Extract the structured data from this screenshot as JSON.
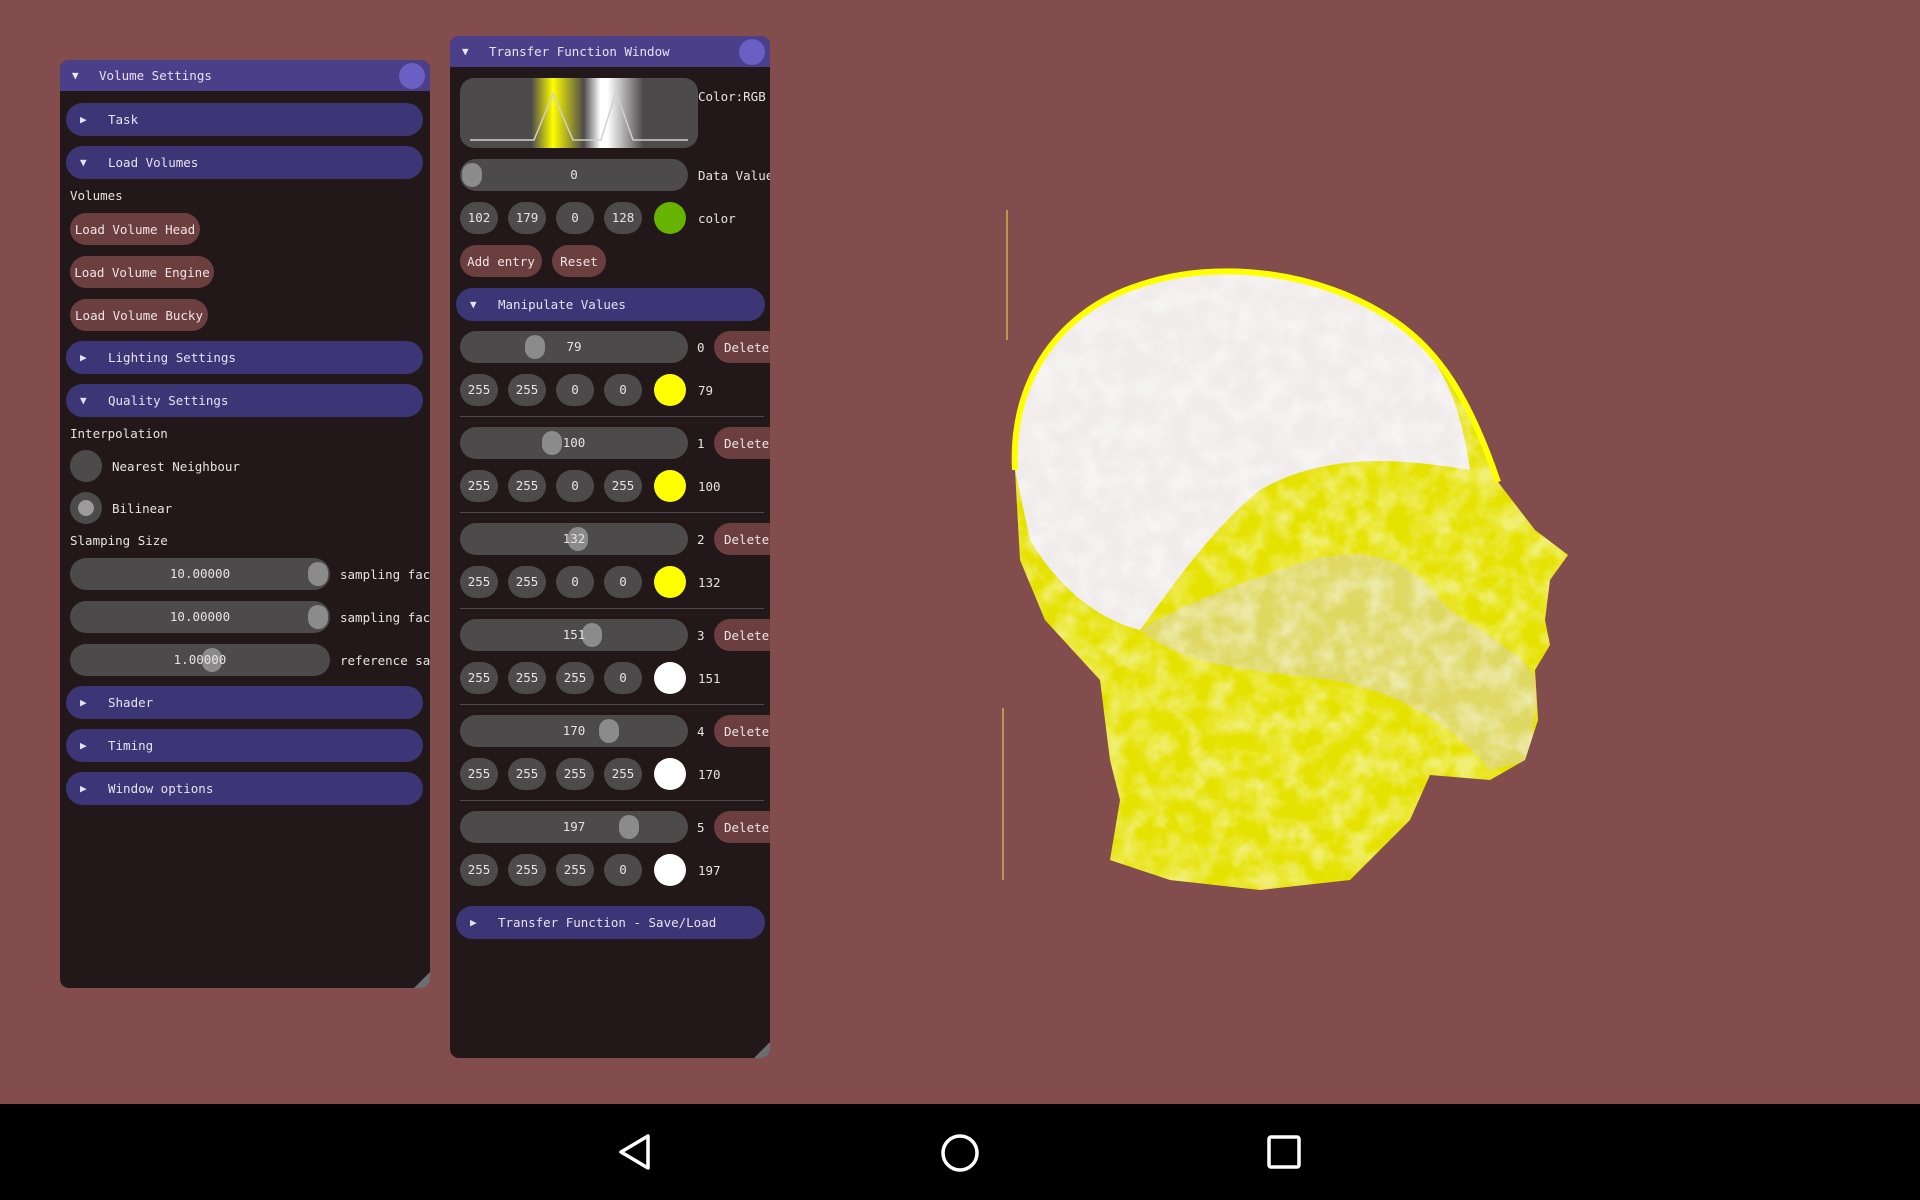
{
  "volume_settings": {
    "title": "Volume Settings",
    "sections": {
      "task": "Task",
      "load_volumes": "Load Volumes",
      "lighting": "Lighting Settings",
      "quality": "Quality Settings",
      "shader": "Shader",
      "timing": "Timing",
      "window_options": "Window options"
    },
    "volumes_label": "Volumes",
    "load_buttons": [
      "Load Volume Head",
      "Load Volume Engine",
      "Load Volume Bucky"
    ],
    "interpolation_label": "Interpolation",
    "interpolation_options": [
      "Nearest Neighbour",
      "Bilinear"
    ],
    "interpolation_selected": "Bilinear",
    "sampling_label": "Slamping Size",
    "sampling_sliders": [
      {
        "value": "10.00000",
        "label": "sampling fac",
        "fraction": 1.0
      },
      {
        "value": "10.00000",
        "label": "sampling fac",
        "fraction": 1.0
      },
      {
        "value": "1.00000",
        "label": "reference sa",
        "fraction": 0.5
      }
    ]
  },
  "transfer_function": {
    "title": "Transfer Function Window",
    "color_mode": "Color:RGB",
    "data_value": {
      "value": "0",
      "label": "Data Value",
      "fraction": 0.0
    },
    "new_color": {
      "r": "102",
      "g": "179",
      "b": "0",
      "a": "128",
      "label": "color",
      "swatch": "#66b300"
    },
    "add_entry": "Add entry",
    "reset": "Reset",
    "manipulate_label": "Manipulate Values",
    "delete_label": "Delete",
    "entries": [
      {
        "index": "0",
        "value": "79",
        "fraction": 0.31,
        "r": "255",
        "g": "255",
        "b": "0",
        "a": "0",
        "swatch": "#ffff00"
      },
      {
        "index": "1",
        "value": "100",
        "fraction": 0.39,
        "r": "255",
        "g": "255",
        "b": "0",
        "a": "255",
        "swatch": "#ffff00"
      },
      {
        "index": "2",
        "value": "132",
        "fraction": 0.52,
        "r": "255",
        "g": "255",
        "b": "0",
        "a": "0",
        "swatch": "#ffff00"
      },
      {
        "index": "3",
        "value": "151",
        "fraction": 0.59,
        "r": "255",
        "g": "255",
        "b": "255",
        "a": "0",
        "swatch": "#ffffff"
      },
      {
        "index": "4",
        "value": "170",
        "fraction": 0.67,
        "r": "255",
        "g": "255",
        "b": "255",
        "a": "255",
        "swatch": "#ffffff"
      },
      {
        "index": "5",
        "value": "197",
        "fraction": 0.77,
        "r": "255",
        "g": "255",
        "b": "255",
        "a": "0",
        "swatch": "#ffffff"
      }
    ],
    "save_load": "Transfer Function - Save/Load"
  },
  "colors": {
    "background": "#834d4e",
    "window_bg": "#221819",
    "title_bar": "#4c3f8a",
    "header": "#3c3676",
    "button": "#6b3e40",
    "yellow": "#ffff00"
  }
}
